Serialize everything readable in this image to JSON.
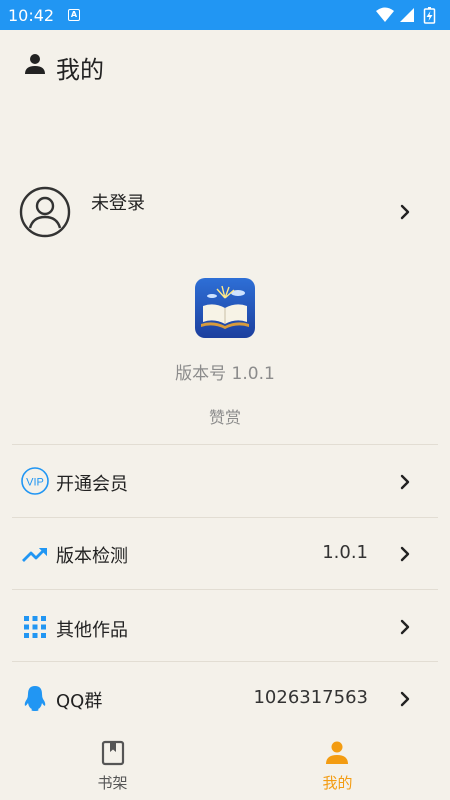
{
  "status_bar": {
    "time": "10:42",
    "notification_letter": "A"
  },
  "header": {
    "title": "我的"
  },
  "profile": {
    "name": "未登录"
  },
  "app": {
    "version": "版本号 1.0.1",
    "donate": "赞赏"
  },
  "list": [
    {
      "icon": "vip-icon",
      "label": "开通会员",
      "value": ""
    },
    {
      "icon": "trending-up-icon",
      "label": "版本检测",
      "value": "1.0.1"
    },
    {
      "icon": "grid-icon",
      "label": "其他作品",
      "value": ""
    },
    {
      "icon": "qq-icon",
      "label": "QQ群",
      "value": "1026317563"
    }
  ],
  "nav": {
    "bookshelf": "书架",
    "mine": "我的"
  },
  "colors": {
    "status_bar": "#2196f3",
    "background": "#f4f1ea",
    "accent_orange": "#f39c12",
    "icon_blue": "#2196f3",
    "muted_text": "#8c8c8c"
  }
}
